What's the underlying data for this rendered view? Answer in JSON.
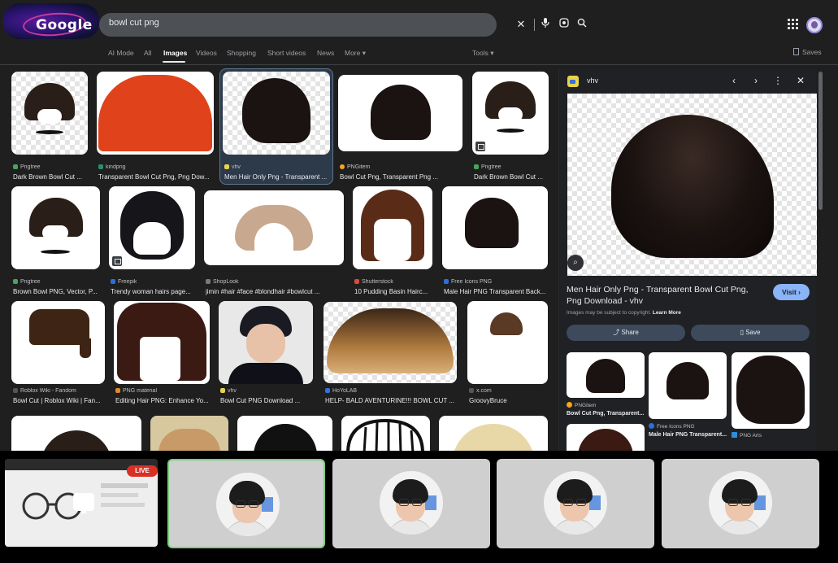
{
  "header": {
    "logo_text": "Google",
    "search_value": "bowl cut png",
    "saves_label": "Saves"
  },
  "tabs": [
    {
      "label": "AI Mode"
    },
    {
      "label": "All"
    },
    {
      "label": "Images"
    },
    {
      "label": "Videos"
    },
    {
      "label": "Shopping"
    },
    {
      "label": "Short videos"
    },
    {
      "label": "News"
    },
    {
      "label": "More ▾"
    },
    {
      "label": "Tools ▾"
    }
  ],
  "results": [
    {
      "source": "Pngtree",
      "title": "Dark Brown Bowl Cut ..."
    },
    {
      "source": "kindpng",
      "title": "Transparent Bowl Cut Png, Png Dow..."
    },
    {
      "source": "vhv",
      "title": "Men Hair Only Png - Transparent ..."
    },
    {
      "source": "PNGitem",
      "title": "Bowl Cut Png, Transparent Png ..."
    },
    {
      "source": "Pngtree",
      "title": "Dark Brown Bowl Cut ..."
    },
    {
      "source": "Pngtree",
      "title": "Brown Bowl PNG, Vector, P..."
    },
    {
      "source": "Freepik",
      "title": "Trendy woman hairs page..."
    },
    {
      "source": "ShopLook",
      "title": "jimin #hair #face #blondhair #bowlcut ..."
    },
    {
      "source": "Shutterstock",
      "title": "10 Pudding Basin Hairc..."
    },
    {
      "source": "Free Icons PNG",
      "title": "Male Hair PNG Transparent Back..."
    },
    {
      "source": "Roblox Wiki - Fandom",
      "title": "Bowl Cut | Roblox Wiki | Fan..."
    },
    {
      "source": "PNG material",
      "title": "Editing Hair PNG: Enhance Yo..."
    },
    {
      "source": "vhv",
      "title": "Bowl Cut PNG Download ..."
    },
    {
      "source": "HoYoLAB",
      "title": "HELP- BALD AVENTURINE!!! BOWL CUT ..."
    },
    {
      "source": "x.com",
      "title": "GroovyBruce"
    }
  ],
  "panel": {
    "source": "vhv",
    "title": "Men Hair Only Png - Transparent Bowl Cut Png, Png Download - vhv",
    "visit_label": "Visit ›",
    "copyright_text": "Images may be subject to copyright.",
    "learn_more": "Learn More",
    "share_label": "Share",
    "save_label": "Save",
    "related": [
      {
        "source": "PNGitem",
        "title": "Bowl Cut Png, Transparent..."
      },
      {
        "source": "Free Icons PNG",
        "title": "Male Hair PNG Transparent..."
      },
      {
        "source": "PNG Arts",
        "title": ""
      }
    ]
  },
  "meeting": {
    "live_label": "LIVE"
  },
  "colors": {
    "accent_blue": "#8ab4f8",
    "live_red": "#d93025",
    "active_tile_border": "#7bd07b"
  }
}
